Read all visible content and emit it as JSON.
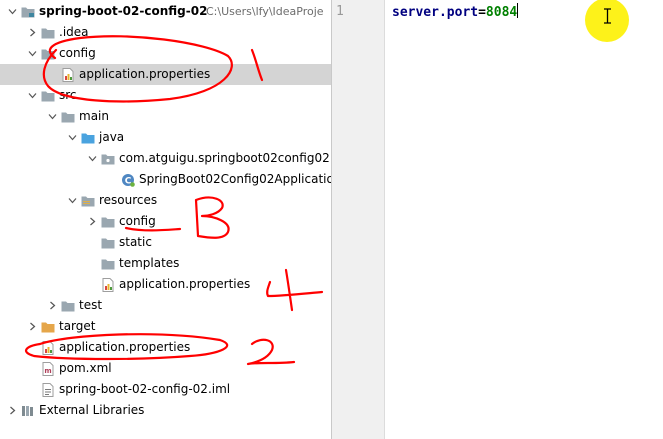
{
  "project_tree": {
    "rows": [
      {
        "label": "spring-boot-02-config-02",
        "path": "C:\\Users\\lfy\\IdeaProje",
        "icon": "module-folder-icon",
        "depth": 0,
        "arrow": "down",
        "bold": true
      },
      {
        "label": ".idea",
        "icon": "folder-icon",
        "depth": 1,
        "arrow": "right"
      },
      {
        "label": "config",
        "icon": "folder-icon",
        "depth": 1,
        "arrow": "down"
      },
      {
        "label": "application.properties",
        "icon": "properties-file-icon",
        "depth": 2,
        "arrow": "none",
        "selected": true
      },
      {
        "label": "src",
        "icon": "folder-icon",
        "depth": 1,
        "arrow": "down"
      },
      {
        "label": "main",
        "icon": "folder-icon",
        "depth": 2,
        "arrow": "down"
      },
      {
        "label": "java",
        "icon": "source-folder-icon",
        "depth": 3,
        "arrow": "down"
      },
      {
        "label": "com.atguigu.springboot02config02",
        "icon": "package-icon",
        "depth": 4,
        "arrow": "down"
      },
      {
        "label": "SpringBoot02Config02Applicatio",
        "icon": "spring-class-icon",
        "depth": 5,
        "arrow": "none"
      },
      {
        "label": "resources",
        "icon": "resources-folder-icon",
        "depth": 3,
        "arrow": "down"
      },
      {
        "label": "config",
        "icon": "folder-icon",
        "depth": 4,
        "arrow": "right"
      },
      {
        "label": "static",
        "icon": "folder-icon",
        "depth": 4,
        "arrow": "none"
      },
      {
        "label": "templates",
        "icon": "folder-icon",
        "depth": 4,
        "arrow": "none"
      },
      {
        "label": "application.properties",
        "icon": "properties-file-icon",
        "depth": 4,
        "arrow": "none"
      },
      {
        "label": "test",
        "icon": "folder-icon",
        "depth": 2,
        "arrow": "right"
      },
      {
        "label": "target",
        "icon": "excluded-folder-icon",
        "depth": 1,
        "arrow": "right"
      },
      {
        "label": "application.properties",
        "icon": "properties-file-icon",
        "depth": 1,
        "arrow": "none"
      },
      {
        "label": "pom.xml",
        "icon": "maven-file-icon",
        "depth": 1,
        "arrow": "none"
      },
      {
        "label": "spring-boot-02-config-02.iml",
        "icon": "iml-file-icon",
        "depth": 1,
        "arrow": "none"
      },
      {
        "label": "External Libraries",
        "icon": "libraries-icon",
        "depth": 0,
        "arrow": "right"
      }
    ]
  },
  "editor": {
    "line_numbers": [
      "1"
    ],
    "code": {
      "key": "server.port",
      "eq": "=",
      "value": "8084"
    }
  },
  "annotations": {
    "colors": {
      "stroke": "#ff0000"
    },
    "labels": [
      "1",
      "2",
      "3",
      "4"
    ]
  },
  "colors": {
    "folder": "#9aa7b0",
    "source_folder": "#4aa3df",
    "excluded_folder": "#e5a64a",
    "selection": "#d4d4d4",
    "cursor_highlight": "#fdf21a"
  }
}
